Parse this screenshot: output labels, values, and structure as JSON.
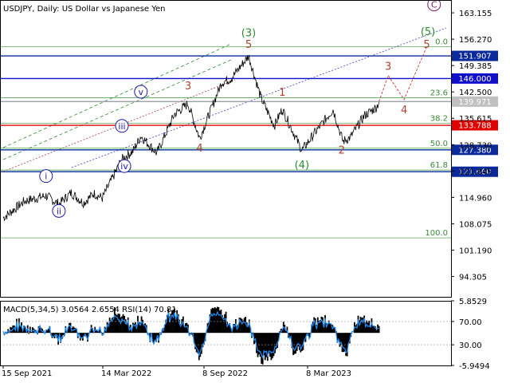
{
  "chart_data": [
    {
      "type": "line",
      "title": "USDJPY, Daily:  US Dollar vs Japanese Yen",
      "symbol": "USDJPY",
      "timeframe": "Daily",
      "description": "US Dollar vs Japanese Yen",
      "xlabel": "",
      "ylabel": "",
      "ylim": [
        89.0,
        166.5
      ],
      "grid": false,
      "x_ticks": [
        "15 Sep 2021",
        "14 Mar 2022",
        "8 Sep 2022",
        "8 Mar 2023"
      ],
      "y_ticks": [
        "163.155",
        "156.270",
        "149.385",
        "142.500",
        "135.615",
        "128.730",
        "121.845",
        "114.960",
        "108.075",
        "101.190",
        "94.305"
      ],
      "price_path": [
        {
          "x": "2021-09-15",
          "y": 109.6
        },
        {
          "x": "2021-10-20",
          "y": 114.0
        },
        {
          "x": "2021-11-24",
          "y": 115.4
        },
        {
          "x": "2021-12-15",
          "y": 113.2
        },
        {
          "x": "2022-01-04",
          "y": 116.2
        },
        {
          "x": "2022-01-24",
          "y": 113.5
        },
        {
          "x": "2022-02-10",
          "y": 116.0
        },
        {
          "x": "2022-02-24",
          "y": 114.8
        },
        {
          "x": "2022-03-28",
          "y": 124.9
        },
        {
          "x": "2022-04-15",
          "y": 127.0
        },
        {
          "x": "2022-04-28",
          "y": 131.0
        },
        {
          "x": "2022-05-24",
          "y": 126.5
        },
        {
          "x": "2022-06-22",
          "y": 136.7
        },
        {
          "x": "2022-07-14",
          "y": 139.4
        },
        {
          "x": "2022-08-02",
          "y": 130.4
        },
        {
          "x": "2022-09-07",
          "y": 145.0
        },
        {
          "x": "2022-09-22",
          "y": 145.9
        },
        {
          "x": "2022-10-21",
          "y": 151.9
        },
        {
          "x": "2022-11-10",
          "y": 141.0
        },
        {
          "x": "2022-12-02",
          "y": 133.7
        },
        {
          "x": "2022-12-15",
          "y": 138.0
        },
        {
          "x": "2023-01-16",
          "y": 127.2
        },
        {
          "x": "2023-02-07",
          "y": 132.0
        },
        {
          "x": "2023-03-08",
          "y": 137.9
        },
        {
          "x": "2023-03-24",
          "y": 129.6
        },
        {
          "x": "2023-04-05",
          "y": 130.6
        },
        {
          "x": "2023-04-28",
          "y": 136.3
        },
        {
          "x": "2023-05-18",
          "y": 138.5
        },
        {
          "x": "2023-05-22",
          "y": 139.97
        }
      ],
      "levels": [
        {
          "name": "151.907",
          "value": 151.907,
          "color": "#0a2a9c",
          "label_bg": "#0a2a9c",
          "label_color": "#ffffff"
        },
        {
          "name": "146.000",
          "value": 146.0,
          "color": "#1010cc",
          "label_bg": "#1010cc",
          "label_color": "#ffffff"
        },
        {
          "name": "139.971",
          "value": 139.971,
          "color": "#9aa0a6",
          "label_bg": "#c0c0c0",
          "label_color": "#ffffff"
        },
        {
          "name": "133.788",
          "value": 133.788,
          "color": "#e00000",
          "label_bg": "#e00000",
          "label_color": "#ffffff"
        },
        {
          "name": "127.380",
          "value": 127.38,
          "color": "#0a2a9c",
          "label_bg": "#0a2a9c",
          "label_color": "#ffffff"
        },
        {
          "name": "121.660",
          "value": 121.66,
          "color": "#0a2a9c",
          "label_bg": "#0a2a9c",
          "label_color": "#ffffff"
        }
      ],
      "fibonacci": [
        {
          "label": "0.0",
          "value": 154.3
        },
        {
          "label": "23.6",
          "value": 141.0
        },
        {
          "label": "38.2",
          "value": 134.3
        },
        {
          "label": "50.0",
          "value": 127.8
        },
        {
          "label": "61.8",
          "value": 122.1
        },
        {
          "label": "100.0",
          "value": 104.4
        }
      ],
      "wave_labels": [
        {
          "text": "C",
          "x": "2023-08-20",
          "y": 164.5,
          "style": "circle",
          "color": "#7a1a6a"
        },
        {
          "text": "(5)",
          "x": "2023-08-10",
          "y": 157.3,
          "style": "plain",
          "color": "#2e8b2e"
        },
        {
          "text": "(3)",
          "x": "2022-10-21",
          "y": 157.0,
          "style": "plain",
          "color": "#2e8b2e"
        },
        {
          "text": "(4)",
          "x": "2023-01-16",
          "y": 122.5,
          "style": "plain",
          "color": "#2e8b2e"
        },
        {
          "text": "5",
          "x": "2022-10-21",
          "y": 154.0,
          "style": "plain",
          "color": "#b04030"
        },
        {
          "text": "3",
          "x": "2022-07-14",
          "y": 143.2,
          "style": "plain",
          "color": "#b04030"
        },
        {
          "text": "4",
          "x": "2022-08-02",
          "y": 126.9,
          "style": "plain",
          "color": "#b04030"
        },
        {
          "text": "1",
          "x": "2022-12-15",
          "y": 141.5,
          "style": "plain",
          "color": "#b04030"
        },
        {
          "text": "2",
          "x": "2023-03-22",
          "y": 126.4,
          "style": "plain",
          "color": "#b04030"
        },
        {
          "text": "3",
          "x": "2023-06-06",
          "y": 148.3,
          "style": "plain",
          "color": "#b04030"
        },
        {
          "text": "4",
          "x": "2023-07-02",
          "y": 136.9,
          "style": "plain",
          "color": "#b04030"
        },
        {
          "text": "5",
          "x": "2023-08-08",
          "y": 154.0,
          "style": "plain",
          "color": "#b04030"
        },
        {
          "text": "i",
          "x": "2021-11-24",
          "y": 119.7,
          "style": "circle",
          "color": "#1a1aaa"
        },
        {
          "text": "ii",
          "x": "2021-12-15",
          "y": 110.6,
          "style": "circle",
          "color": "#1a1aaa"
        },
        {
          "text": "iii",
          "x": "2022-03-28",
          "y": 132.8,
          "style": "circle",
          "color": "#1a1aaa"
        },
        {
          "text": "iv",
          "x": "2022-04-01",
          "y": 122.3,
          "style": "circle",
          "color": "#1a1aaa"
        },
        {
          "text": "v",
          "x": "2022-04-28",
          "y": 141.7,
          "style": "circle",
          "color": "#1a1aaa"
        }
      ]
    },
    {
      "type": "line",
      "title": "MACD(5,34,5) 3.0564 2.6554 RSI(14) 70.81",
      "indicator": "MACD(5,34,5)",
      "macd_value": "3.0564",
      "signal_value": "2.6554",
      "rsi_label": "RSI(14)",
      "rsi_value": "70.81",
      "ylim": [
        -5.9494,
        5.8529
      ],
      "y_ticks": [
        "5.8529",
        "70.00",
        "30.00",
        "-5.9494"
      ],
      "rsi_levels": [
        70,
        30
      ],
      "grid": false
    }
  ]
}
